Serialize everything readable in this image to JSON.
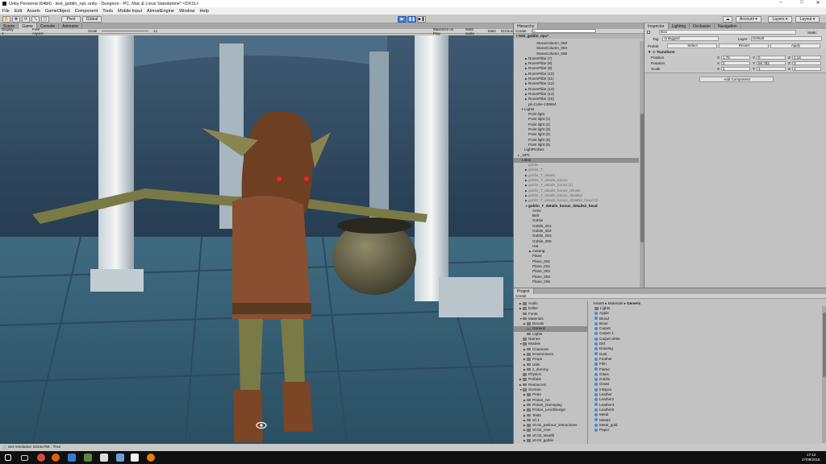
{
  "window": {
    "title": "Unity Personal (64bit) - test_goblin_npc.unity - Dungeon - PC, Mac & Linux Standalone* <DX11>"
  },
  "menu": [
    "File",
    "Edit",
    "Assets",
    "GameObject",
    "Component",
    "Tools",
    "Mobile Input",
    "AlmostEngine",
    "Window",
    "Help"
  ],
  "toolbar": {
    "pivot": "Pivot",
    "global": "Global",
    "account": "Account",
    "layers": "Layers",
    "layout": "Layout"
  },
  "scene_tabs": [
    {
      "label": "Scene"
    },
    {
      "label": "Game"
    },
    {
      "label": "Console"
    },
    {
      "label": "Animator"
    }
  ],
  "game_bar": {
    "display": "Display 1",
    "aspect": "Free Aspect",
    "scale_label": "Scale",
    "scale_value": "1x",
    "maximize": "Maximize on Play",
    "mute": "Mute audio",
    "stats": "Stats",
    "gizmos": "Gizmos"
  },
  "hierarchy": {
    "tab": "Hierarchy",
    "create": "Create",
    "search_placeholder": "All",
    "scene": "test_goblin_npc*",
    "rows": [
      {
        "t": "StoneColumn_093",
        "i": 4,
        "a": ""
      },
      {
        "t": "StoneColumn_094",
        "i": 4,
        "a": ""
      },
      {
        "t": "StoneColumn_095",
        "i": 4,
        "a": ""
      },
      {
        "t": "RoomPillar (7)",
        "i": 2,
        "a": "▶"
      },
      {
        "t": "RoomPillar (8)",
        "i": 2,
        "a": "▶"
      },
      {
        "t": "RoomPillar (9)",
        "i": 2,
        "a": "▶"
      },
      {
        "t": "RoomPillar (10)",
        "i": 2,
        "a": "▶"
      },
      {
        "t": "RoomPillar (11)",
        "i": 2,
        "a": "▶"
      },
      {
        "t": "RoomPillar (12)",
        "i": 2,
        "a": "▶"
      },
      {
        "t": "RoomPillar (13)",
        "i": 2,
        "a": "▶"
      },
      {
        "t": "RoomPillar (14)",
        "i": 2,
        "a": "▶"
      },
      {
        "t": "RoomPillar (15)",
        "i": 2,
        "a": "▶"
      },
      {
        "t": "pb-Cube-139664",
        "i": 2,
        "a": ""
      },
      {
        "t": "Lights",
        "i": 1,
        "a": "▼"
      },
      {
        "t": "Point light",
        "i": 2,
        "a": ""
      },
      {
        "t": "Point light (1)",
        "i": 2,
        "a": ""
      },
      {
        "t": "Point light (2)",
        "i": 2,
        "a": ""
      },
      {
        "t": "Point light (3)",
        "i": 2,
        "a": ""
      },
      {
        "t": "Point light (4)",
        "i": 2,
        "a": ""
      },
      {
        "t": "Point light (5)",
        "i": 2,
        "a": ""
      },
      {
        "t": "Point light (6)",
        "i": 2,
        "a": ""
      },
      {
        "t": "LightProbes",
        "i": 1,
        "a": ""
      },
      {
        "t": "_NPC",
        "i": 0,
        "a": "▼"
      },
      {
        "t": "Boo",
        "i": 1,
        "a": "▼",
        "s": true
      },
      {
        "t": "goblin",
        "i": 2,
        "a": "",
        "d": true
      },
      {
        "t": "goblin_T",
        "i": 2,
        "a": "▶",
        "d": true
      },
      {
        "t": "goblin_T_details",
        "i": 2,
        "a": "▶",
        "d": true
      },
      {
        "t": "goblin_T_details_bonus",
        "i": 2,
        "a": "▶",
        "d": true
      },
      {
        "t": "goblin_T_details_bonus (1)",
        "i": 2,
        "a": "▶",
        "d": true
      },
      {
        "t": "goblin_T_details_bonus_details",
        "i": 2,
        "a": "▶",
        "d": true
      },
      {
        "t": "goblin_T_details_bonus_details2",
        "i": 2,
        "a": "▶",
        "d": true
      },
      {
        "t": "goblin_T_details_bonus_details2_head (1)",
        "i": 2,
        "a": "▶",
        "d": true
      },
      {
        "t": "goblin_T_details_bonus_details2_head",
        "i": 2,
        "a": "▼",
        "b": true
      },
      {
        "t": "Arms",
        "i": 3,
        "a": ""
      },
      {
        "t": "Belt",
        "i": 3,
        "a": ""
      },
      {
        "t": "Goblin",
        "i": 3,
        "a": ""
      },
      {
        "t": "Goblin_001",
        "i": 3,
        "a": ""
      },
      {
        "t": "Goblin_002",
        "i": 3,
        "a": ""
      },
      {
        "t": "Goblin_003",
        "i": 3,
        "a": ""
      },
      {
        "t": "Goblin_005",
        "i": 3,
        "a": ""
      },
      {
        "t": "Hat",
        "i": 3,
        "a": ""
      },
      {
        "t": "metarig",
        "i": 3,
        "a": "▶"
      },
      {
        "t": "Plane",
        "i": 3,
        "a": ""
      },
      {
        "t": "Plane_001",
        "i": 3,
        "a": ""
      },
      {
        "t": "Plane_002",
        "i": 3,
        "a": ""
      },
      {
        "t": "Plane_003",
        "i": 3,
        "a": ""
      },
      {
        "t": "Plane_004",
        "i": 3,
        "a": ""
      },
      {
        "t": "Plane_005",
        "i": 3,
        "a": ""
      }
    ]
  },
  "inspector": {
    "tabs": [
      "Inspector",
      "Lighting",
      "Occlusion",
      "Navigation"
    ],
    "object_name": "Boo",
    "static": "Static",
    "tag_label": "Tag",
    "tag": "Untagged",
    "layer_label": "Layer",
    "layer": "Default",
    "prefab_label": "Prefab",
    "select": "Select",
    "revert": "Revert",
    "apply": "Apply",
    "transform": "Transform",
    "rows": [
      {
        "label": "Position",
        "x": "1.76",
        "y": "0",
        "z": "4.14"
      },
      {
        "label": "Rotation",
        "x": "0",
        "y": "56.782",
        "z": "0"
      },
      {
        "label": "Scale",
        "x": "1",
        "y": "1",
        "z": "1"
      }
    ],
    "add_component": "Add Component"
  },
  "project": {
    "tab": "Project",
    "create": "Create",
    "breadcrumb": [
      "Assets",
      "Materials",
      "Generic"
    ],
    "tree": [
      {
        "t": "Audio",
        "i": 1,
        "a": "▶"
      },
      {
        "t": "Editor",
        "i": 1,
        "a": "▶"
      },
      {
        "t": "Fonts",
        "i": 1,
        "a": ""
      },
      {
        "t": "Materials",
        "i": 1,
        "a": "▼"
      },
      {
        "t": "Decals",
        "i": 2,
        "a": "▶"
      },
      {
        "t": "Generic",
        "i": 2,
        "a": "",
        "s": true
      },
      {
        "t": "Lights",
        "i": 2,
        "a": ""
      },
      {
        "t": "Names",
        "i": 1,
        "a": ""
      },
      {
        "t": "Models",
        "i": 1,
        "a": "▼"
      },
      {
        "t": "Character",
        "i": 2,
        "a": "▶"
      },
      {
        "t": "Environment",
        "i": 2,
        "a": "▶"
      },
      {
        "t": "Props",
        "i": 2,
        "a": "▶"
      },
      {
        "t": "Utils",
        "i": 2,
        "a": "▶"
      },
      {
        "t": "z_dummy",
        "i": 2,
        "a": "▶"
      },
      {
        "t": "Physics",
        "i": 1,
        "a": ""
      },
      {
        "t": "Prefabs",
        "i": 1,
        "a": "▶"
      },
      {
        "t": "Resources",
        "i": 1,
        "a": "▶"
      },
      {
        "t": "Scenes",
        "i": 1,
        "a": "▼"
      },
      {
        "t": "Proto",
        "i": 2,
        "a": "▶"
      },
      {
        "t": "Protos_Art",
        "i": 2,
        "a": "▶"
      },
      {
        "t": "Protos_Gameplay",
        "i": 2,
        "a": "▶"
      },
      {
        "t": "Protos_LevelDesign",
        "i": 2,
        "a": "▶"
      },
      {
        "t": "Tests",
        "i": 2,
        "a": "▶"
      },
      {
        "t": "v0.1",
        "i": 2,
        "a": "▶"
      },
      {
        "t": "v0.01_parkour_interactions",
        "i": 2,
        "a": "▶"
      },
      {
        "t": "v0.02_core",
        "i": 2,
        "a": "▶"
      },
      {
        "t": "v0.03_stealth",
        "i": 2,
        "a": "▶"
      },
      {
        "t": "v0.04_goblin",
        "i": 2,
        "a": "▶"
      }
    ],
    "files": [
      {
        "t": "Lights",
        "f": true
      },
      {
        "t": "Apple"
      },
      {
        "t": "Blood"
      },
      {
        "t": "Bone"
      },
      {
        "t": "Carpet"
      },
      {
        "t": "Carpet 1"
      },
      {
        "t": "Carpet white"
      },
      {
        "t": "Dirt"
      },
      {
        "t": "Drawing"
      },
      {
        "t": "Dust"
      },
      {
        "t": "Feather"
      },
      {
        "t": "Film"
      },
      {
        "t": "Flame"
      },
      {
        "t": "Glass"
      },
      {
        "t": "Goblin"
      },
      {
        "t": "Grass"
      },
      {
        "t": "Inkspot"
      },
      {
        "t": "Leather"
      },
      {
        "t": "Leather2"
      },
      {
        "t": "Leather4"
      },
      {
        "t": "Leather5"
      },
      {
        "t": "Metal"
      },
      {
        "t": "Metal2"
      },
      {
        "t": "Metal_gold"
      },
      {
        "t": "Paper"
      }
    ]
  },
  "status": {
    "text": "Set resolution 1024x768 : True"
  },
  "taskbar": {
    "time": "17:12",
    "date": "27/08/2016"
  }
}
